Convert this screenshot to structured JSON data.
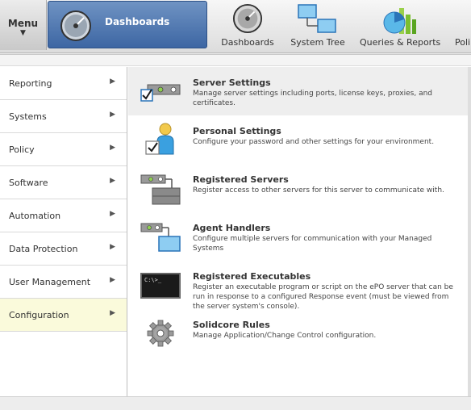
{
  "topbar": {
    "menu_label": "Menu",
    "menu_arrow": "▼",
    "dashboard_tab_label": "Dashboards",
    "quick_nav": [
      {
        "label": "Dashboards",
        "icon": "gauge-icon"
      },
      {
        "label": "System Tree",
        "icon": "system-tree-icon"
      },
      {
        "label": "Queries & Reports",
        "icon": "queries-reports-icon"
      },
      {
        "label": "Poli",
        "icon": "policy-icon"
      }
    ]
  },
  "menu": {
    "categories": [
      {
        "label": "Reporting",
        "arrow": "▶",
        "active": false
      },
      {
        "label": "Systems",
        "arrow": "▶",
        "active": false
      },
      {
        "label": "Policy",
        "arrow": "▶",
        "active": false
      },
      {
        "label": "Software",
        "arrow": "▶",
        "active": false
      },
      {
        "label": "Automation",
        "arrow": "▶",
        "active": false
      },
      {
        "label": "Data Protection",
        "arrow": "▶",
        "active": false
      },
      {
        "label": "User Management",
        "arrow": "▶",
        "active": false
      },
      {
        "label": "Configuration",
        "arrow": "▶",
        "active": true
      }
    ],
    "entries": [
      {
        "title": "Server Settings",
        "desc": "Manage server settings including ports, license keys, proxies, and certificates.",
        "icon": "server-settings-icon"
      },
      {
        "title": "Personal Settings",
        "desc": "Configure your password and other settings for your environment.",
        "icon": "personal-settings-icon"
      },
      {
        "title": "Registered Servers",
        "desc": "Register access to other servers for this server to communicate with.",
        "icon": "registered-servers-icon"
      },
      {
        "title": "Agent Handlers",
        "desc": "Configure multiple servers for communication with your Managed Systems",
        "icon": "agent-handlers-icon"
      },
      {
        "title": "Registered Executables",
        "desc": "Register an executable program or script on the ePO server that can be run in response to a configured Response event (must be viewed from the server system's console).",
        "icon": "registered-executables-icon",
        "console_text": "C:\\>_"
      },
      {
        "title": "Solidcore Rules",
        "desc": "Manage Application/Change Control configuration.",
        "icon": "gear-icon"
      }
    ]
  },
  "colors": {
    "accent": "#3d66a3",
    "active_category_bg": "#fafadb",
    "highlight_entry_bg": "#eeeeee"
  }
}
